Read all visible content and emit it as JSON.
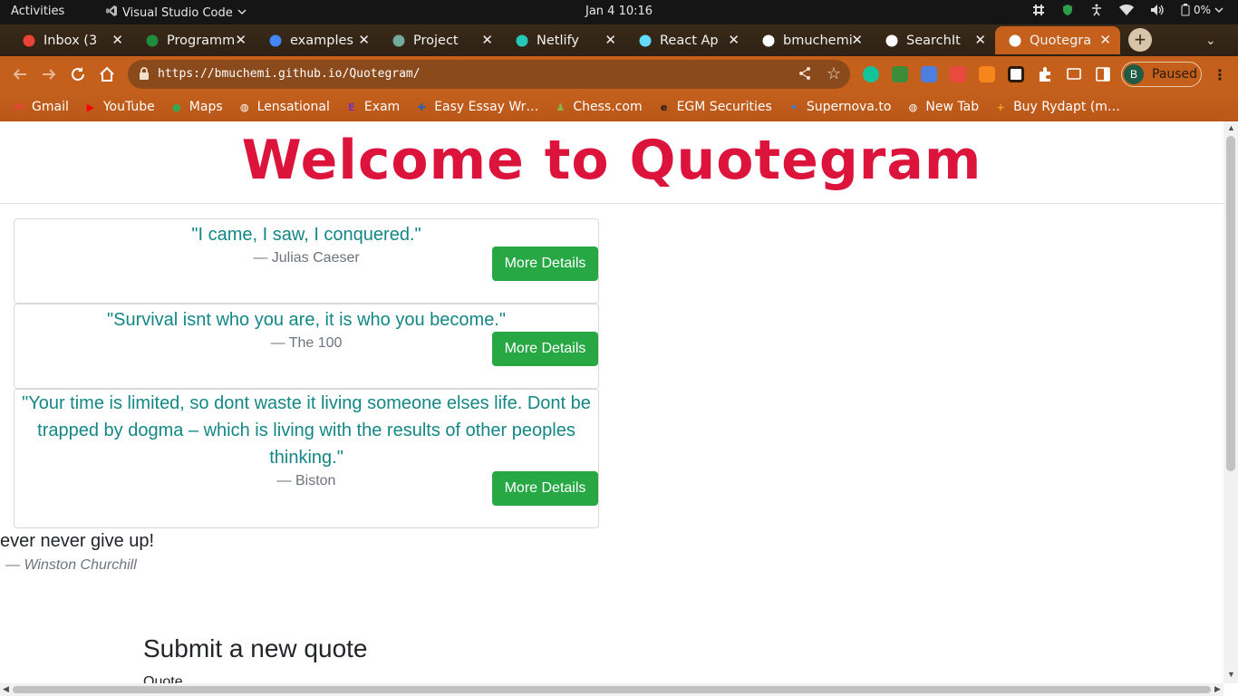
{
  "system_bar": {
    "activities": "Activities",
    "app_name": "Visual Studio Code",
    "clock": "Jan 4  10:16",
    "battery": "0%"
  },
  "tabs": [
    {
      "title": "Inbox (3",
      "icon": "gmail-icon",
      "color": "#ea4335"
    },
    {
      "title": "Programm",
      "icon": "google-classroom-icon",
      "color": "#1e8e3e"
    },
    {
      "title": "examples",
      "icon": "google-icon",
      "color": "#4285f4"
    },
    {
      "title": "Project",
      "icon": "chatgpt-icon",
      "color": "#74aa9c"
    },
    {
      "title": "Netlify",
      "icon": "netlify-icon",
      "color": "#25c7b7"
    },
    {
      "title": "React Ap",
      "icon": "react-icon",
      "color": "#61dafb"
    },
    {
      "title": "bmuchemi",
      "icon": "github-icon",
      "color": "#ffffff"
    },
    {
      "title": "SearchIt",
      "icon": "angular-icon",
      "color": "#ffffff"
    },
    {
      "title": "Quotegra",
      "icon": "angular-icon",
      "color": "#ffffff",
      "active": true
    }
  ],
  "address_bar": {
    "url": "https://bmuchemi.github.io/Quotegram/"
  },
  "profile": {
    "initial": "B",
    "status": "Paused"
  },
  "bookmarks": [
    {
      "label": "Gmail",
      "icon": "gmail-icon",
      "glyph": "M",
      "color": "#ea4335"
    },
    {
      "label": "YouTube",
      "icon": "youtube-icon",
      "glyph": "▶",
      "color": "#ff0000"
    },
    {
      "label": "Maps",
      "icon": "maps-icon",
      "glyph": "●",
      "color": "#34a853"
    },
    {
      "label": "Lensational",
      "icon": "globe-icon",
      "glyph": "◍",
      "color": "#ffffff"
    },
    {
      "label": "Exam",
      "icon": "exam-icon",
      "glyph": "E",
      "color": "#7b2fbf"
    },
    {
      "label": "Easy Essay Wr…",
      "icon": "essay-icon",
      "glyph": "✚",
      "color": "#2b5fb8"
    },
    {
      "label": "Chess.com",
      "icon": "chess-icon",
      "glyph": "♟",
      "color": "#81b64c"
    },
    {
      "label": "EGM Securities",
      "icon": "egm-icon",
      "glyph": "e",
      "color": "#1a1a1a"
    },
    {
      "label": "Supernova.to",
      "icon": "supernova-icon",
      "glyph": "✦",
      "color": "#3b7ddd"
    },
    {
      "label": "New Tab",
      "icon": "globe-icon",
      "glyph": "◍",
      "color": "#ffffff"
    },
    {
      "label": "Buy Rydapt (m…",
      "icon": "rydapt-icon",
      "glyph": "+",
      "color": "#f5a623"
    }
  ],
  "page": {
    "heading": "Welcome to Quotegram",
    "button_label": "More Details",
    "quotes": [
      {
        "text": "\"I came, I saw, I conquered.\"",
        "author": "— Julias Caeser"
      },
      {
        "text": "\"Survival isnt who you are, it is who you become.\"",
        "author": "— The 100"
      },
      {
        "text": "\"Your time is limited, so dont waste it living someone elses life. Dont be trapped by dogma – which is living with the results of other peoples thinking.\"",
        "author": "— Biston"
      }
    ],
    "featured_quote": "ever never give up!",
    "featured_author": "— Winston Churchill",
    "submit_title": "Submit a new quote",
    "quote_label": "Quote"
  }
}
